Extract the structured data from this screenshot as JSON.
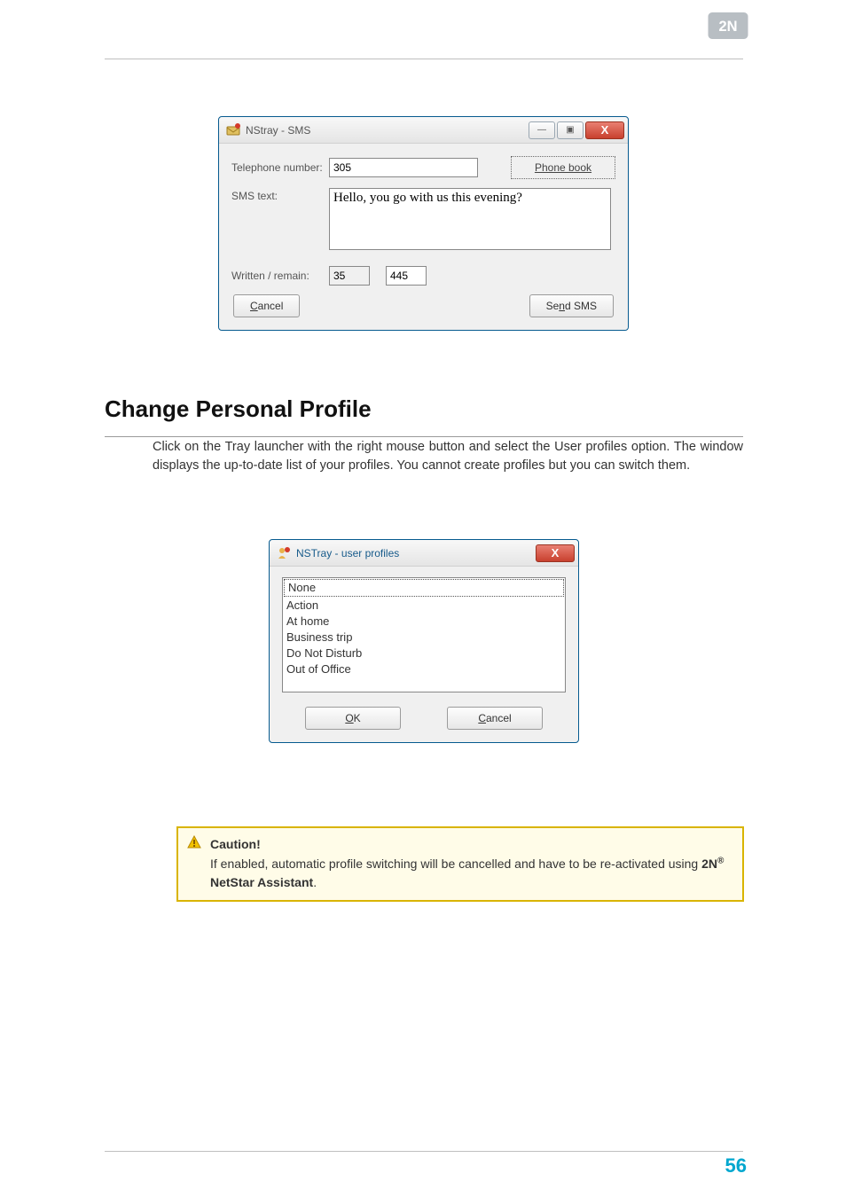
{
  "logo_text": "2N",
  "sms": {
    "window_title": "NStray - SMS",
    "btn_min": "—",
    "btn_max": "▣",
    "btn_close": "X",
    "telephone_label": "Telephone number:",
    "telephone_value": "305",
    "phone_book_prefix": "P",
    "phone_book_rest": "hone book",
    "sms_text_label": "SMS text:",
    "sms_text_value": "Hello, you go with us this evening?",
    "written_remain_label": "Written / remain:",
    "written_value": "35",
    "remain_value": "445",
    "cancel_prefix": "C",
    "cancel_rest": "ancel",
    "send_pre": "Se",
    "send_u": "n",
    "send_post": "d SMS"
  },
  "section": {
    "heading": "Change Personal Profile",
    "body": "Click on the Tray launcher with the right mouse button and select the User profiles option. The window displays the up-to-date list of your profiles. You cannot create profiles but you can switch them."
  },
  "profiles": {
    "window_title": "NSTray - user profiles",
    "btn_close": "X",
    "items": [
      "None",
      "Action",
      "At home",
      "Business trip",
      "Do Not Disturb",
      "Out of Office"
    ],
    "ok_prefix": "O",
    "ok_rest": "K",
    "cancel_prefix": "C",
    "cancel_rest": "ancel"
  },
  "caution": {
    "title": "Caution!",
    "text_pre": "If enabled, automatic profile switching will be cancelled and have to be re-activated using ",
    "brand_pre": "2N",
    "brand_sup": "®",
    "brand_post": " NetStar Assistant",
    "text_post": "."
  },
  "page_number": "56"
}
